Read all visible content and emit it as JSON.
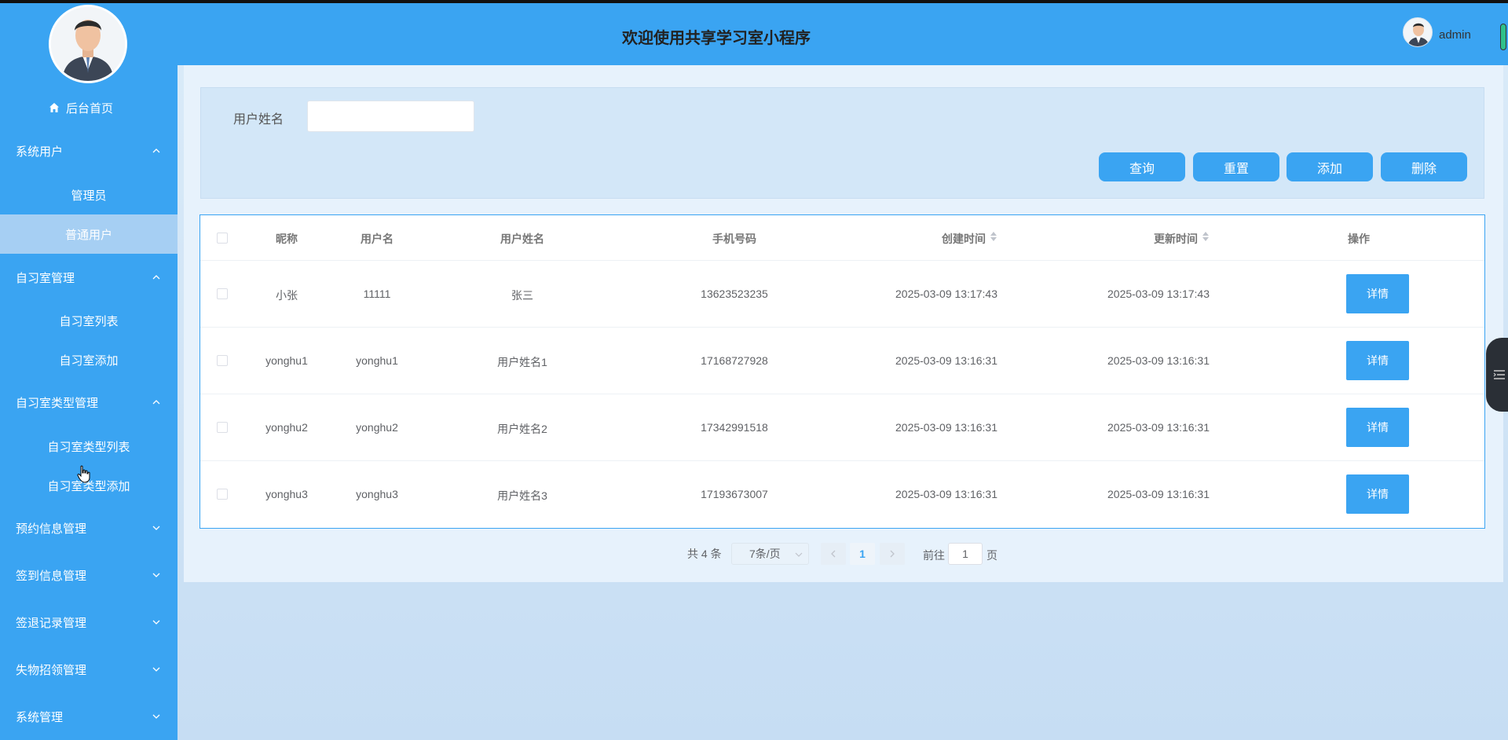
{
  "header": {
    "title": "欢迎使用共享学习室小程序",
    "username": "admin"
  },
  "sidebar": {
    "home_label": "后台首页",
    "groups": [
      {
        "label": "系统用户",
        "expanded": true,
        "items": [
          "管理员",
          "普通用户"
        ]
      },
      {
        "label": "自习室管理",
        "expanded": true,
        "items": [
          "自习室列表",
          "自习室添加"
        ]
      },
      {
        "label": "自习室类型管理",
        "expanded": true,
        "items": [
          "自习室类型列表",
          "自习室类型添加"
        ]
      },
      {
        "label": "预约信息管理",
        "expanded": false,
        "items": []
      },
      {
        "label": "签到信息管理",
        "expanded": false,
        "items": []
      },
      {
        "label": "签退记录管理",
        "expanded": false,
        "items": []
      },
      {
        "label": "失物招领管理",
        "expanded": false,
        "items": []
      },
      {
        "label": "系统管理",
        "expanded": false,
        "items": []
      }
    ],
    "active_item": "普通用户"
  },
  "search": {
    "label": "用户姓名",
    "value": "",
    "placeholder": "",
    "buttons": {
      "query": "查询",
      "reset": "重置",
      "add": "添加",
      "delete": "删除"
    }
  },
  "table": {
    "columns": [
      "昵称",
      "用户名",
      "用户姓名",
      "手机号码",
      "创建时间",
      "更新时间",
      "操作"
    ],
    "rows": [
      {
        "nickname": "小张",
        "username": "11111",
        "realname": "张三",
        "phone": "13623523235",
        "created": "2025-03-09 13:17:43",
        "updated": "2025-03-09 13:17:43",
        "action": "详情"
      },
      {
        "nickname": "yonghu1",
        "username": "yonghu1",
        "realname": "用户姓名1",
        "phone": "17168727928",
        "created": "2025-03-09 13:16:31",
        "updated": "2025-03-09 13:16:31",
        "action": "详情"
      },
      {
        "nickname": "yonghu2",
        "username": "yonghu2",
        "realname": "用户姓名2",
        "phone": "17342991518",
        "created": "2025-03-09 13:16:31",
        "updated": "2025-03-09 13:16:31",
        "action": "详情"
      },
      {
        "nickname": "yonghu3",
        "username": "yonghu3",
        "realname": "用户姓名3",
        "phone": "17193673007",
        "created": "2025-03-09 13:16:31",
        "updated": "2025-03-09 13:16:31",
        "action": "详情"
      }
    ]
  },
  "pagination": {
    "total": "共 4 条",
    "page_size": "7条/页",
    "current_page": "1",
    "goto_label": "前往",
    "goto_value": "1",
    "page_suffix": "页"
  },
  "colors": {
    "primary": "#3aa4f2",
    "active_item_bg": "#a6cff3"
  }
}
